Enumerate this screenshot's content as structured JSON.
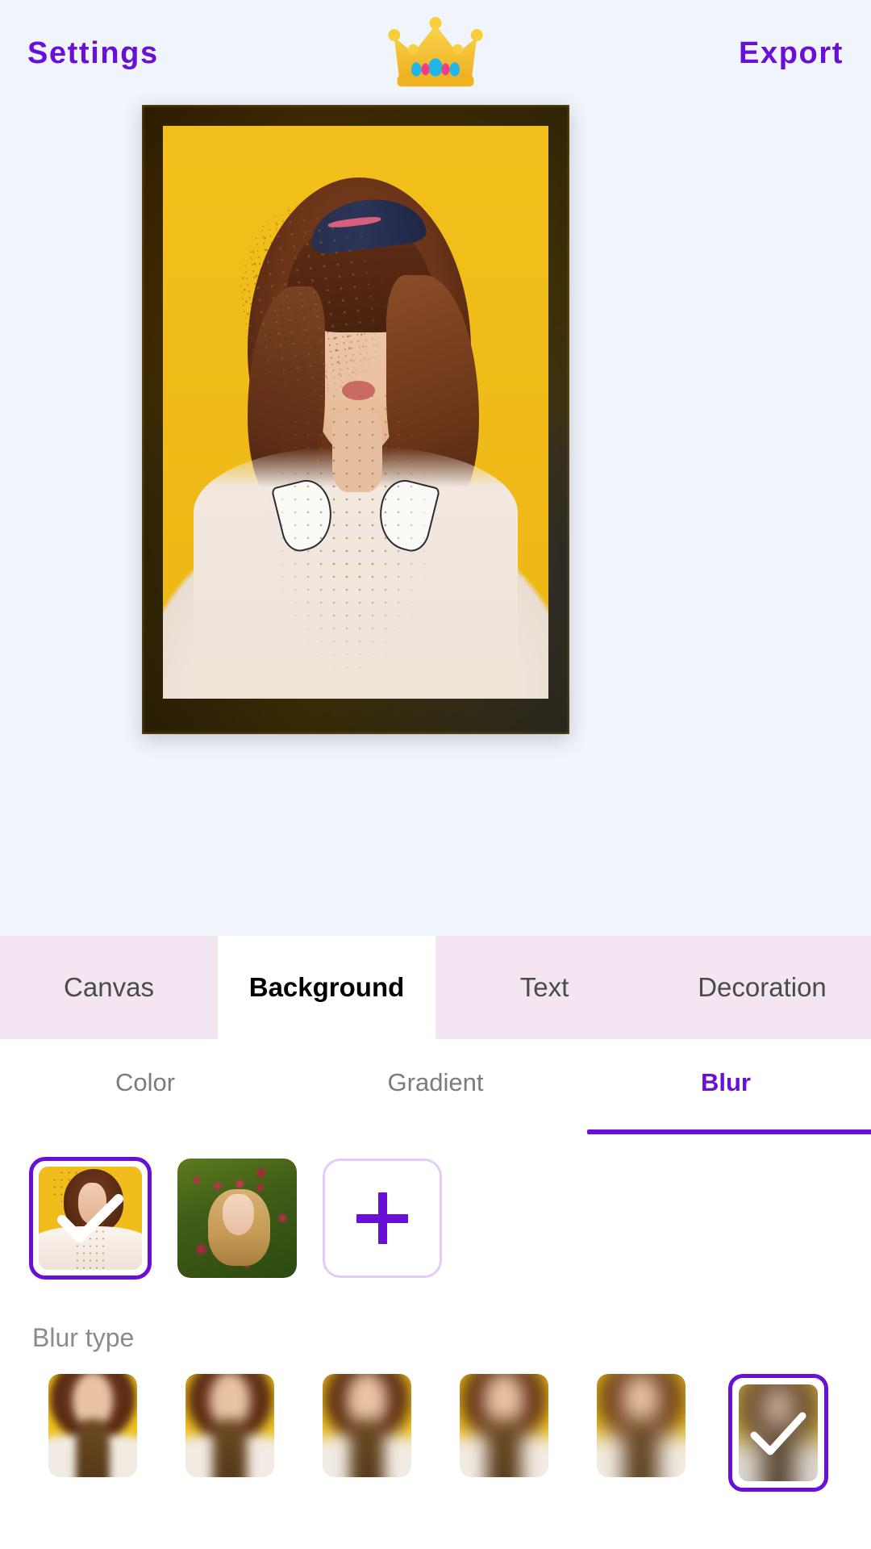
{
  "header": {
    "settings_label": "Settings",
    "export_label": "Export",
    "logo_icon": "crown-icon",
    "accent_color": "#6a0fd6",
    "background_color": "#f0f4fb"
  },
  "canvas": {
    "name": "photo-canvas",
    "background_effect": "blur",
    "frame_colors": [
      "#6d5510",
      "#8c7212",
      "#7c7258",
      "#6f6a5e"
    ],
    "photo_description": "woman with dried flowers on yellow background"
  },
  "tabs": {
    "active": "Background",
    "items": [
      {
        "label": "Canvas",
        "name": "tab-canvas",
        "active": false
      },
      {
        "label": "Background",
        "name": "tab-background",
        "active": true
      },
      {
        "label": "Text",
        "name": "tab-text",
        "active": false
      },
      {
        "label": "Decoration",
        "name": "tab-decoration",
        "active": false
      }
    ]
  },
  "subtabs": {
    "active": "Blur",
    "items": [
      {
        "label": "Color",
        "name": "subtab-color",
        "active": false
      },
      {
        "label": "Gradient",
        "name": "subtab-gradient",
        "active": false
      },
      {
        "label": "Blur",
        "name": "subtab-blur",
        "active": true
      }
    ]
  },
  "image_picker": {
    "items": [
      {
        "name": "background-image-1",
        "alt": "portrait yellow background",
        "selected": true
      },
      {
        "name": "background-image-2",
        "alt": "portrait with rose crown",
        "selected": false
      }
    ],
    "add_button": {
      "name": "add-image-button",
      "icon": "plus-icon",
      "label": "+"
    }
  },
  "blur_type": {
    "label": "Blur type",
    "selected_index": 5,
    "items": [
      {
        "name": "blur-type-1",
        "level": 1,
        "selected": false
      },
      {
        "name": "blur-type-2",
        "level": 2,
        "selected": false
      },
      {
        "name": "blur-type-3",
        "level": 3,
        "selected": false
      },
      {
        "name": "blur-type-4",
        "level": 4,
        "selected": false
      },
      {
        "name": "blur-type-5",
        "level": 5,
        "selected": false
      },
      {
        "name": "blur-type-6",
        "level": 6,
        "selected": true
      }
    ]
  },
  "icons": {
    "check": "check-icon",
    "plus": "plus-icon",
    "crown": "crown-icon"
  }
}
